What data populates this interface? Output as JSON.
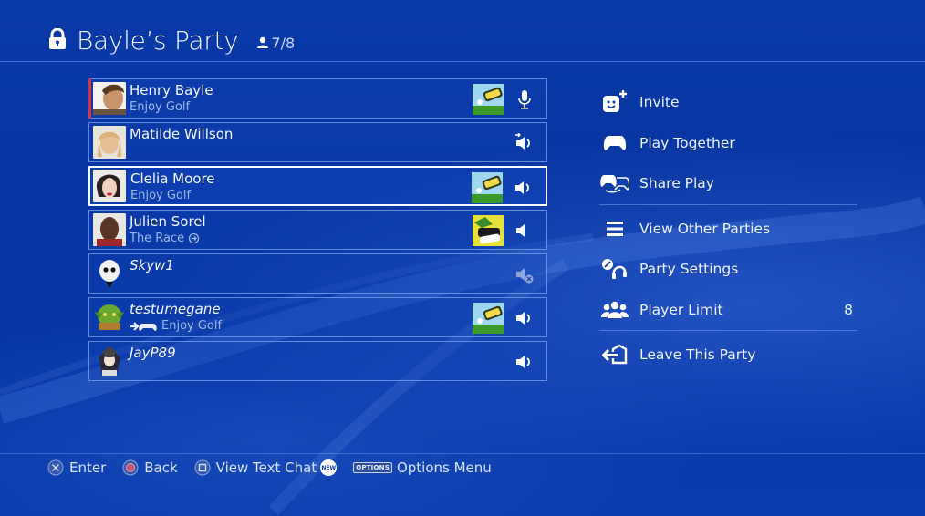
{
  "header": {
    "title": "Bayle’s Party",
    "member_count": "7/8",
    "lock_icon": "lock-icon",
    "person_icon": "person-icon"
  },
  "members": [
    {
      "name": "Henry Bayle",
      "status": "Enjoy Golf",
      "status_icon": "",
      "game": "Enjoy Golf",
      "voice": "microphone-speaking",
      "italic": false,
      "selected": false,
      "speaking": true
    },
    {
      "name": "Matilde Willson",
      "status": "",
      "status_icon": "",
      "game": "",
      "voice": "speaker-transfer",
      "italic": false,
      "selected": false,
      "speaking": false
    },
    {
      "name": "Clelia Moore",
      "status": "Enjoy Golf",
      "status_icon": "",
      "game": "Enjoy Golf",
      "voice": "speaker-on",
      "italic": false,
      "selected": true,
      "speaking": false
    },
    {
      "name": "Julien Sorel",
      "status": "The Race",
      "status_icon": "circle-arrow-icon",
      "game": "The Race",
      "voice": "speaker-low",
      "italic": false,
      "selected": false,
      "speaking": false
    },
    {
      "name": "Skyw1",
      "status": "",
      "status_icon": "",
      "game": "",
      "voice": "speaker-muted",
      "italic": true,
      "selected": false,
      "speaking": false
    },
    {
      "name": "testumegane",
      "status": "Enjoy Golf",
      "status_icon": "join-game-icon",
      "game": "Enjoy Golf",
      "voice": "speaker-on",
      "italic": true,
      "selected": false,
      "speaking": false
    },
    {
      "name": "JayP89",
      "status": "",
      "status_icon": "",
      "game": "",
      "voice": "speaker-on",
      "italic": true,
      "selected": false,
      "speaking": false
    }
  ],
  "menu": {
    "items": [
      {
        "label": "Invite",
        "icon": "invite-icon"
      },
      {
        "label": "Play Together",
        "icon": "controller-icon"
      },
      {
        "label": "Share Play",
        "icon": "share-play-icon"
      },
      {
        "label": "View Other Parties",
        "icon": "list-icon"
      },
      {
        "label": "Party Settings",
        "icon": "party-settings-icon"
      },
      {
        "label": "Player Limit",
        "icon": "players-icon",
        "value": "8"
      },
      {
        "label": "Leave This Party",
        "icon": "leave-icon"
      }
    ]
  },
  "footer": {
    "enter_label": "Enter",
    "back_label": "Back",
    "text_chat_label": "View Text Chat",
    "new_badge": "NEW",
    "options_badge": "OPTIONS",
    "options_label": "Options Menu"
  },
  "colors": {
    "background": "#0736a6",
    "speaking_indicator": "#e03040",
    "secondary_text": "#9fb7ea"
  }
}
